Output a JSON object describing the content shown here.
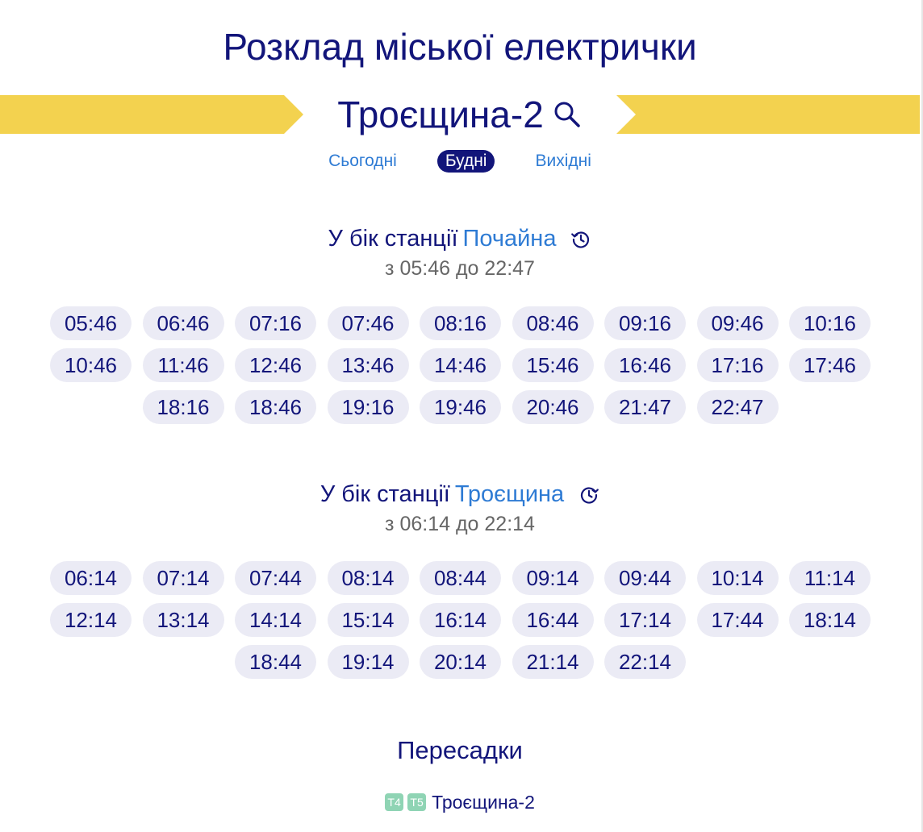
{
  "page": {
    "title": "Розклад міської електрички"
  },
  "station": {
    "name": "Троєщина-2",
    "search_icon": "search-icon"
  },
  "tabs": [
    {
      "label": "Сьогодні",
      "active": false
    },
    {
      "label": "Будні",
      "active": true
    },
    {
      "label": "Вихідні",
      "active": false
    }
  ],
  "directions": [
    {
      "prefix": "У бік станції",
      "station": "Почайна",
      "icon": "history-icon",
      "range": "з 05:46 до 22:47",
      "times": [
        "05:46",
        "06:46",
        "07:16",
        "07:46",
        "08:16",
        "08:46",
        "09:16",
        "09:46",
        "10:16",
        "10:46",
        "11:46",
        "12:46",
        "13:46",
        "14:46",
        "15:46",
        "16:46",
        "17:16",
        "17:46",
        "18:16",
        "18:46",
        "19:16",
        "19:46",
        "20:46",
        "21:47",
        "22:47"
      ]
    },
    {
      "prefix": "У бік станції",
      "station": "Троєщина",
      "icon": "clock-forward-icon",
      "range": "з 06:14 до 22:14",
      "times": [
        "06:14",
        "07:14",
        "07:44",
        "08:14",
        "08:44",
        "09:14",
        "09:44",
        "10:14",
        "11:14",
        "12:14",
        "13:14",
        "14:14",
        "15:14",
        "16:14",
        "16:44",
        "17:14",
        "17:44",
        "18:14",
        "18:44",
        "19:14",
        "20:14",
        "21:14",
        "22:14"
      ]
    }
  ],
  "transfers": {
    "title": "Пересадки",
    "items": [
      {
        "badges": [
          "T4",
          "T5"
        ],
        "name": "Троєщина-2"
      }
    ]
  },
  "colors": {
    "primary": "#12157a",
    "link": "#2e7bd4",
    "accent_yellow": "#f3d24f",
    "chip_bg": "#ebebf5",
    "badge_green": "#8fd4b4",
    "muted": "#666666"
  }
}
